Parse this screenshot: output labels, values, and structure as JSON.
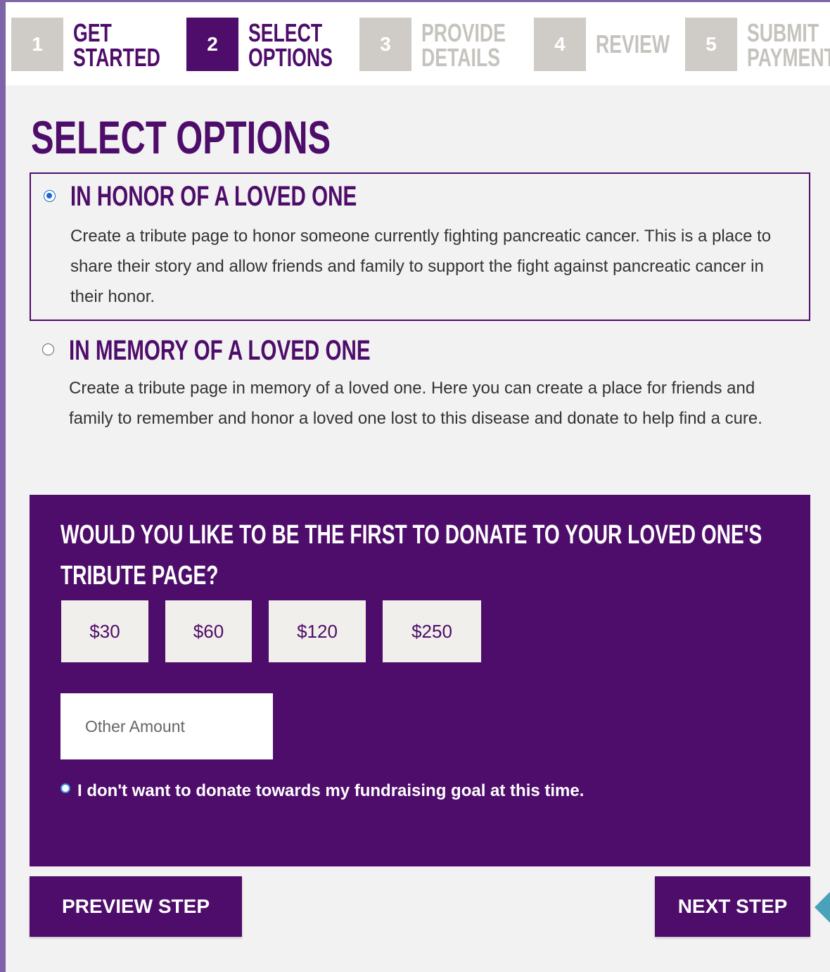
{
  "stepper": {
    "steps": [
      {
        "number": "1",
        "label_line1": "GET",
        "label_line2": "STARTED"
      },
      {
        "number": "2",
        "label_line1": "SELECT",
        "label_line2": "OPTIONS"
      },
      {
        "number": "3",
        "label_line1": "PROVIDE",
        "label_line2": "DETAILS"
      },
      {
        "number": "4",
        "label_line1": "REVIEW",
        "label_line2": ""
      },
      {
        "number": "5",
        "label_line1": "SUBMIT",
        "label_line2": "PAYMENT"
      }
    ]
  },
  "page": {
    "title": "SELECT OPTIONS"
  },
  "options": [
    {
      "title": "IN HONOR OF A LOVED ONE",
      "description": "Create a tribute page to honor someone currently fighting pancreatic cancer. This is a place to share their story and allow friends and family to support the fight against pancreatic cancer in their honor."
    },
    {
      "title": "IN MEMORY OF A LOVED ONE",
      "description": "Create a tribute page in memory of a loved one. Here you can create a place for friends and family to remember and honor a loved one lost to this disease and donate to help find a cure."
    }
  ],
  "donation": {
    "heading": "WOULD YOU LIKE TO BE THE FIRST TO DONATE TO YOUR LOVED ONE'S TRIBUTE PAGE?",
    "amounts": [
      "$30",
      "$60",
      "$120",
      "$250"
    ],
    "other_placeholder": "Other Amount",
    "no_donate_text": "I don't want to donate towards my fundraising goal at this time."
  },
  "nav": {
    "previous_label": "PREVIEW STEP",
    "next_label": "NEXT STEP"
  },
  "colors": {
    "brand": "#4e0d6a",
    "step_inactive": "#cfccc7",
    "radio": "#1a66d9",
    "pointer": "#4aa2b8"
  }
}
